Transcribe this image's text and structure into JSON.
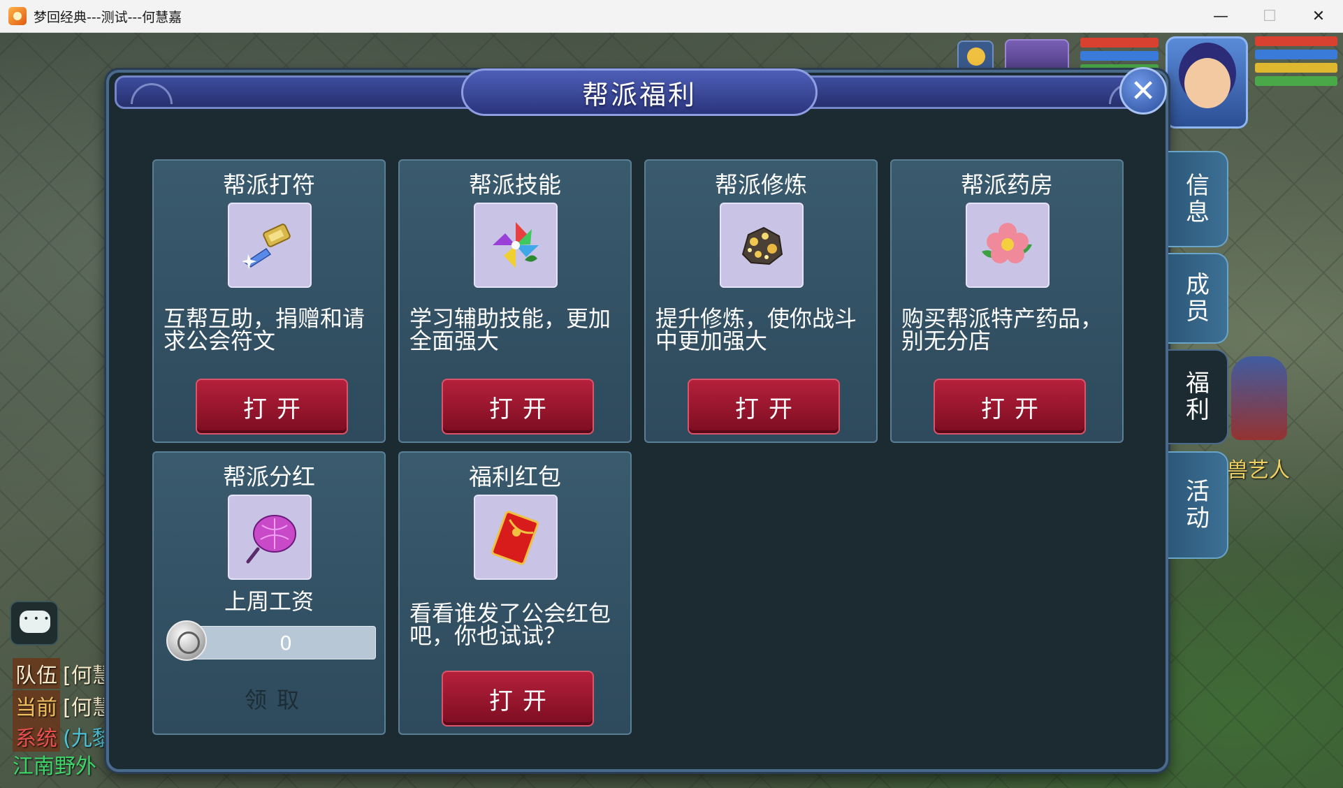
{
  "window": {
    "title": "梦回经典---测试---何慧嘉",
    "minimize_glyph": "—",
    "maximize_glyph": "☐",
    "close_glyph": "✕"
  },
  "dialog": {
    "title": "帮派福利",
    "close_glyph": "✕"
  },
  "cards": [
    {
      "title": "帮派打符",
      "icon": "talisman-icon",
      "desc": "互帮互助，捐赠和请求公会符文",
      "button": "打开"
    },
    {
      "title": "帮派技能",
      "icon": "pinwheel-icon",
      "desc": "学习辅助技能，更加全面强大",
      "button": "打开"
    },
    {
      "title": "帮派修炼",
      "icon": "ore-icon",
      "desc": "提升修炼，使你战斗中更加强大",
      "button": "打开"
    },
    {
      "title": "帮派药房",
      "icon": "flower-icon",
      "desc": "购买帮派特产药品，别无分店",
      "button": "打开"
    },
    {
      "title": "帮派分红",
      "icon": "purse-icon",
      "salary_label": "上周工资",
      "salary_value": "0",
      "button": "领取"
    },
    {
      "title": "福利红包",
      "icon": "red-envelope-icon",
      "desc": "看看谁发了公会红包吧，你也试试？",
      "button": "打开"
    }
  ],
  "side_tabs": [
    {
      "label": "信\n息",
      "active": false
    },
    {
      "label": "成\n员",
      "active": false
    },
    {
      "label": "福\n利",
      "active": true
    },
    {
      "label": "活\n动",
      "active": false
    }
  ],
  "chat": {
    "lines": [
      {
        "channel": "队伍",
        "text": "[何慧",
        "color": "#f4e9c8"
      },
      {
        "channel": "当前",
        "text": "[何慧",
        "color": "#f4e9c8"
      },
      {
        "channel": "系统",
        "text": "(九黎",
        "color": "#4fc3d8"
      }
    ],
    "location": "江南野外"
  },
  "npc": {
    "name": "兽艺人"
  }
}
